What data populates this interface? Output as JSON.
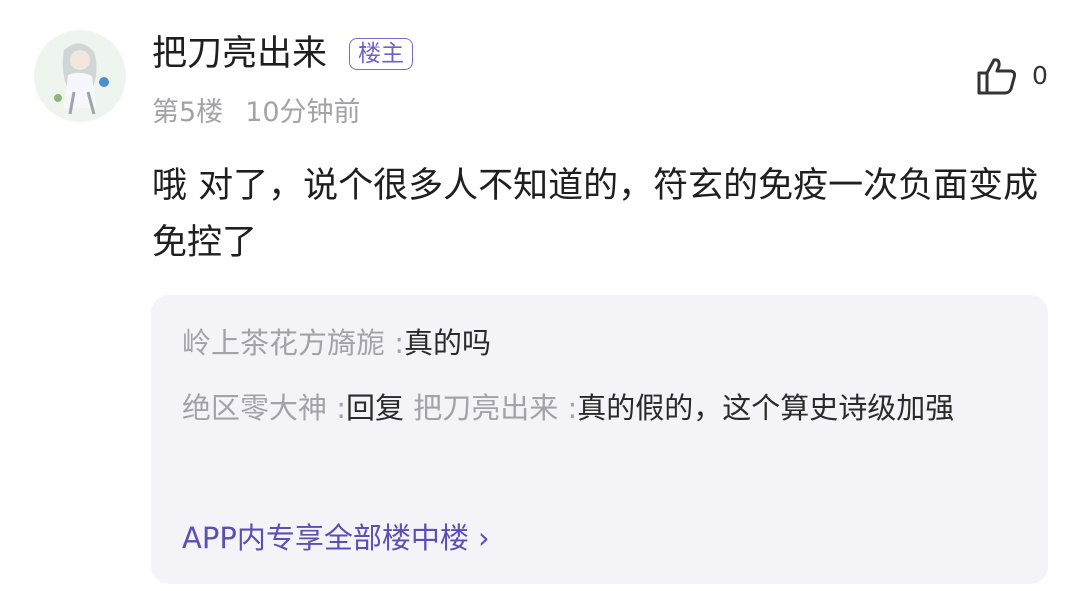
{
  "post": {
    "username": "把刀亮出来",
    "badge": "楼主",
    "floor": "第5楼",
    "time": "10分钟前",
    "like_count": "0",
    "content": "哦 对了，说个很多人不知道的，符玄的免疫一次负面变成免控了"
  },
  "replies": [
    {
      "author": "岭上茶花方旖旎 :",
      "text": "真的吗"
    },
    {
      "author": "绝区零大神 :",
      "reply_word": "回复",
      "target": "把刀亮出来 :",
      "text": "真的假的，这个算史诗级加强"
    }
  ],
  "more_link": "APP内专享全部楼中楼 ›",
  "icons": {
    "like": "thumbs-up-icon",
    "avatar": "anime-character-avatar"
  },
  "colors": {
    "accent": "#6f5fc7",
    "muted": "#a2a2a8",
    "panel": "#f4f4f8"
  }
}
